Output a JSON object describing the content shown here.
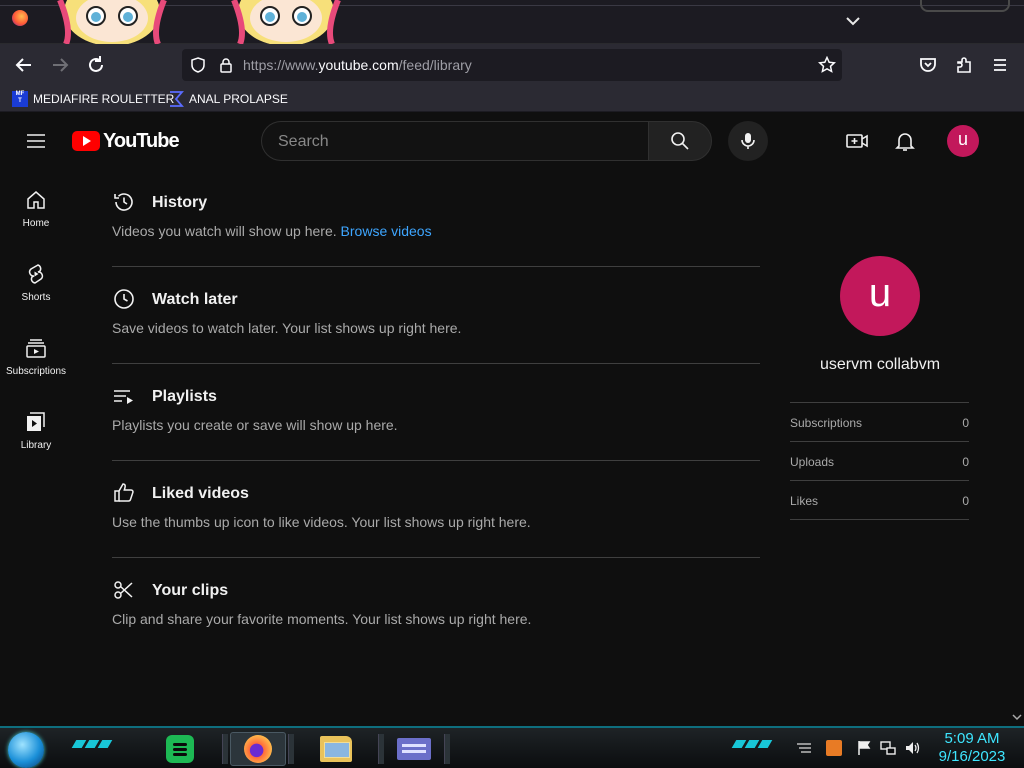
{
  "browser": {
    "url_prefix": "https://www.",
    "url_domain": "youtube.com",
    "url_path": "/feed/library",
    "bookmarks": [
      {
        "label": "MEDIAFIRE ROULETTER",
        "icon": "mediafire-favicon"
      },
      {
        "label": "ANAL PROLAPSE",
        "icon": "sigma-favicon"
      }
    ]
  },
  "youtube": {
    "logo_text": "YouTube",
    "search_placeholder": "Search",
    "avatar_letter": "u",
    "guide": [
      {
        "label": "Home",
        "icon": "home-icon"
      },
      {
        "label": "Shorts",
        "icon": "shorts-icon"
      },
      {
        "label": "Subscriptions",
        "icon": "subscriptions-icon"
      },
      {
        "label": "Library",
        "icon": "library-icon"
      }
    ],
    "sections": [
      {
        "title": "History",
        "desc": "Videos you watch will show up here.",
        "link": "Browse videos",
        "icon": "history-icon"
      },
      {
        "title": "Watch later",
        "desc": "Save videos to watch later. Your list shows up right here.",
        "icon": "watch-later-icon"
      },
      {
        "title": "Playlists",
        "desc": "Playlists you create or save will show up here.",
        "icon": "playlists-icon"
      },
      {
        "title": "Liked videos",
        "desc": "Use the thumbs up icon to like videos. Your list shows up right here.",
        "icon": "thumbs-up-icon"
      },
      {
        "title": "Your clips",
        "desc": "Clip and share your favorite moments. Your list shows up right here.",
        "icon": "scissors-icon"
      }
    ],
    "profile": {
      "name": "uservm collabvm",
      "stats": [
        {
          "label": "Subscriptions",
          "value": "0"
        },
        {
          "label": "Uploads",
          "value": "0"
        },
        {
          "label": "Likes",
          "value": "0"
        }
      ]
    },
    "colors": {
      "accent_red": "#ff0000",
      "avatar": "#c2185b",
      "link": "#3ea6ff"
    }
  },
  "taskbar": {
    "time": "5:09 AM",
    "date": "9/16/2023",
    "apps": [
      "spotify-icon",
      "firefox-icon",
      "file-explorer-icon",
      "app-window-icon"
    ]
  }
}
